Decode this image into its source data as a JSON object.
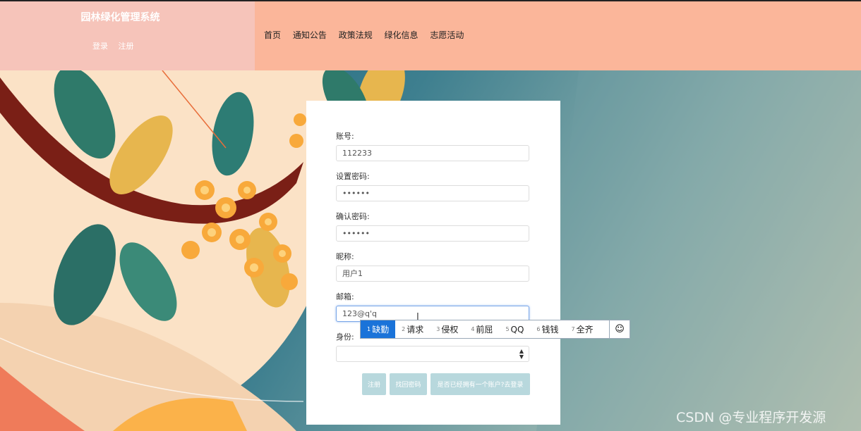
{
  "header": {
    "site_title": "园林绿化管理系统",
    "login_label": "登录",
    "register_label": "注册",
    "nav": [
      "首页",
      "通知公告",
      "政策法规",
      "绿化信息",
      "志愿活动"
    ]
  },
  "form": {
    "account_label": "账号:",
    "account_value": "112233",
    "password_label": "设置密码:",
    "password_value": "••••••",
    "confirm_label": "确认密码:",
    "confirm_value": "••••••",
    "nickname_label": "昵称:",
    "nickname_value": "用户1",
    "email_label": "邮箱:",
    "email_value": "123@q'q",
    "identity_label": "身份:",
    "identity_value": "",
    "register_button": "注册",
    "recover_button": "找回密码",
    "login_link_button": "是否已经拥有一个账户?去登录"
  },
  "ime": {
    "candidates": [
      {
        "num": "1",
        "text": "缺勤"
      },
      {
        "num": "2",
        "text": "请求"
      },
      {
        "num": "3",
        "text": "侵权"
      },
      {
        "num": "4",
        "text": "前屈"
      },
      {
        "num": "5",
        "text": "QQ"
      },
      {
        "num": "6",
        "text": "钱钱"
      },
      {
        "num": "7",
        "text": "全齐"
      }
    ],
    "emoji": "☺"
  },
  "watermark": "CSDN @专业程序开发源",
  "colors": {
    "header_left": "#f6c4ba",
    "header_right": "#fbb69a",
    "button": "#b8d8dd",
    "ime_active": "#1a73d9"
  }
}
